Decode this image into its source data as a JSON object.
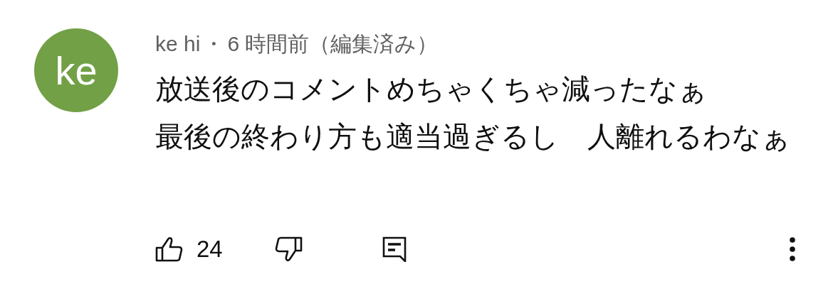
{
  "comment": {
    "avatar": "ke",
    "author": "ke hi",
    "separator": "・",
    "time": "6 時間前（編集済み）",
    "lines": [
      "放送後のコメントめちゃくちゃ減ったなぁ",
      "最後の終わり方も適当過ぎるし　人離れるわなぁ"
    ],
    "likes": "24"
  }
}
